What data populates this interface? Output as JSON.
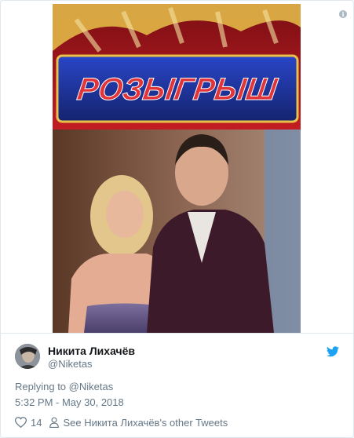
{
  "tweet": {
    "image_banner_text": "РОЗЫГРЫШ",
    "author_name": "Никита Лихачёв",
    "author_handle": "@Niketas",
    "replying_prefix": "Replying to ",
    "replying_to": "@Niketas",
    "timestamp": "5:32 PM - May 30, 2018",
    "like_count": "14",
    "other_tweets_link": "See Никита Лихачёв's other Tweets"
  },
  "icons": {
    "info": "info-icon",
    "bird": "twitter-bird-icon",
    "heart": "heart-icon",
    "person": "person-icon"
  },
  "colors": {
    "twitter_blue": "#1da1f2",
    "secondary_text": "#657786",
    "banner_red": "#e0353a",
    "banner_blue": "#1b2f8c"
  }
}
